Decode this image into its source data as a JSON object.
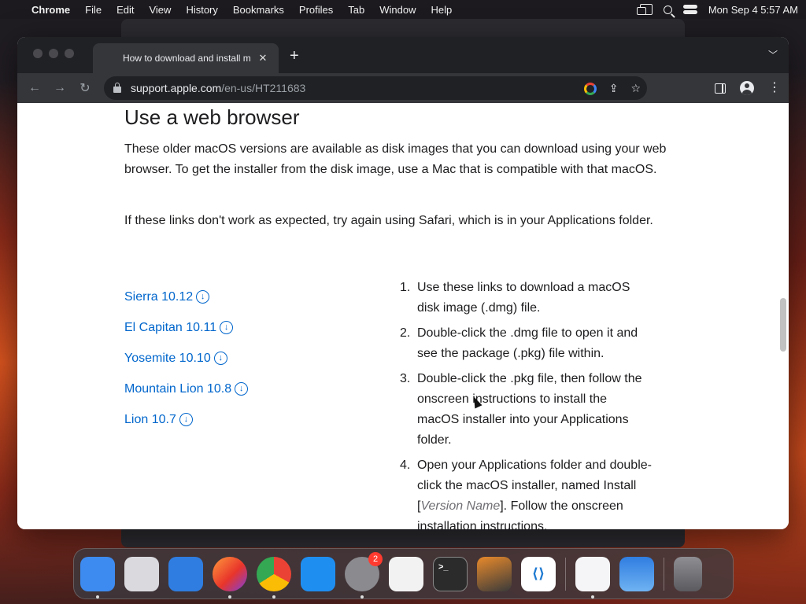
{
  "menubar": {
    "app_name": "Chrome",
    "items": [
      "File",
      "Edit",
      "View",
      "History",
      "Bookmarks",
      "Profiles",
      "Tab",
      "Window",
      "Help"
    ],
    "clock": "Mon Sep 4  5:57 AM"
  },
  "browser": {
    "tab_title": "How to download and install m",
    "tab_close": "✕",
    "new_tab": "+",
    "url_host": "support.apple.com",
    "url_path": "/en-us/HT211683"
  },
  "page": {
    "heading": "Use a web browser",
    "para1": "These older macOS versions are available as disk images that you can download using your web browser. To get the installer from the disk image, use a Mac that is compatible with that macOS.",
    "para2": "If these links don't work as expected, try again using Safari, which is in your Applications folder.",
    "links": [
      {
        "label": "Sierra 10.12"
      },
      {
        "label": "El Capitan 10.11"
      },
      {
        "label": "Yosemite 10.10"
      },
      {
        "label": "Mountain Lion 10.8"
      },
      {
        "label": "Lion 10.7"
      }
    ],
    "steps": [
      {
        "num": "1.",
        "text": "Use these links to download a macOS disk image (.dmg) file."
      },
      {
        "num": "2.",
        "text": "Double-click the .dmg file to open it and see the package (.pkg) file within."
      },
      {
        "num": "3.",
        "text": "Double-click the .pkg file, then follow the onscreen instructions to install the macOS installer into your Applications folder."
      },
      {
        "num": "4.",
        "text_before": "Open your Applications folder and double-click the macOS installer, named Install [",
        "text_em": "Version Name",
        "text_after": "]. Follow the onscreen installation instructions."
      }
    ]
  },
  "dock": {
    "apps": [
      {
        "name": "finder-icon",
        "color": "#3d8bf0"
      },
      {
        "name": "launchpad-icon",
        "color": "#d9d9de"
      },
      {
        "name": "safari-icon",
        "color": "#2f7de1"
      },
      {
        "name": "firefox-icon",
        "color": "#7b3fe0"
      },
      {
        "name": "chrome-icon",
        "color": "#e8e8e8"
      },
      {
        "name": "app-store-icon",
        "color": "#1f8ef1"
      },
      {
        "name": "system-settings-icon",
        "color": "#8a8a8f",
        "badge": "2"
      },
      {
        "name": "textedit-icon",
        "color": "#f2f2f2"
      },
      {
        "name": "terminal-icon",
        "color": "#2b2b2b"
      },
      {
        "name": "garageband-icon",
        "color": "#3a3a3a"
      },
      {
        "name": "vscode-icon",
        "color": "#ffffff"
      },
      {
        "name": "visual-studio-icon",
        "color": "#f5f5f7"
      },
      {
        "name": "weather-icon",
        "color": "#3a8ee8"
      },
      {
        "name": "trash-icon",
        "color": "#6b6b70"
      }
    ]
  }
}
